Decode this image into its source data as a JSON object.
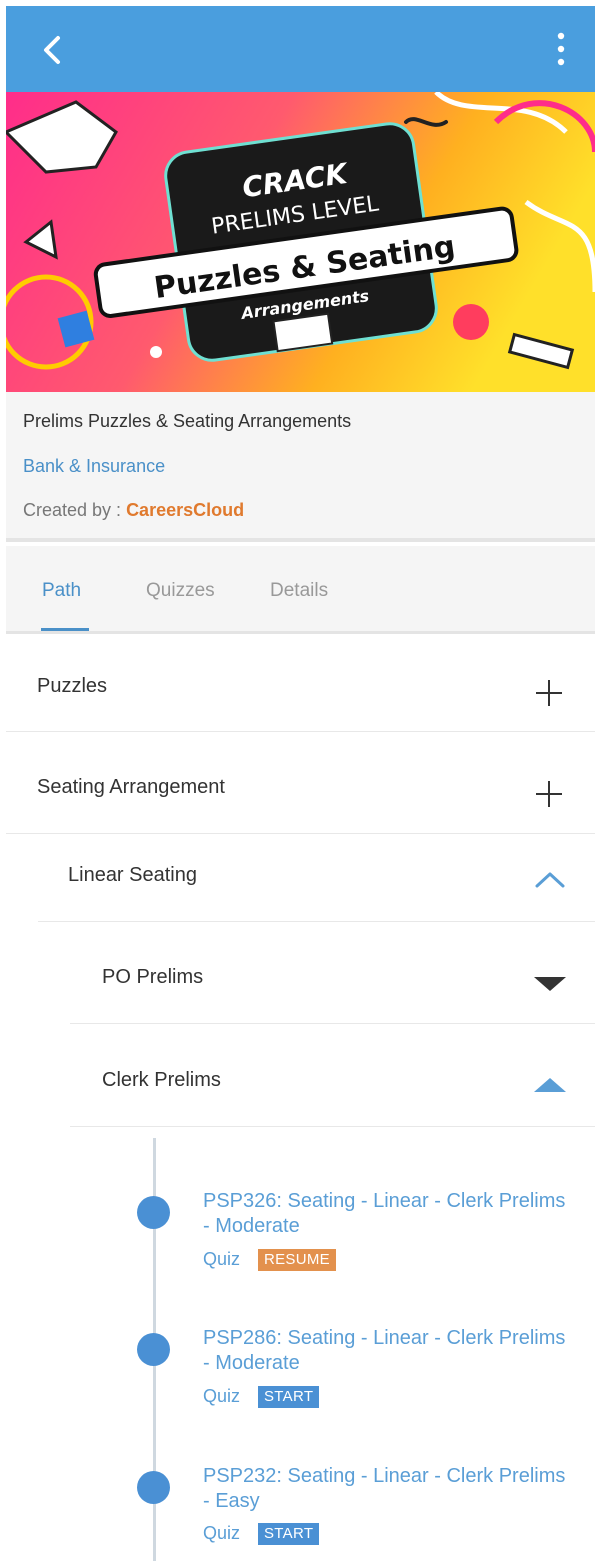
{
  "course": {
    "title": "Prelims Puzzles & Seating Arrangements",
    "category": "Bank & Insurance",
    "creator_label": "Created by : ",
    "creator_name": "CareersCloud"
  },
  "banner": {
    "line1": "CRACK",
    "line2": "PRELIMS LEVEL",
    "line3": "Puzzles & Seating",
    "line4": "Arrangements"
  },
  "tabs": [
    {
      "label": "Path",
      "active": true
    },
    {
      "label": "Quizzes",
      "active": false
    },
    {
      "label": "Details",
      "active": false
    }
  ],
  "path": {
    "sections": [
      {
        "label": "Puzzles",
        "icon": "plus-icon"
      },
      {
        "label": "Seating Arrangement",
        "icon": "plus-icon"
      }
    ],
    "subsection": {
      "label": "Linear Seating",
      "icon": "chevron-up-icon"
    },
    "groups": [
      {
        "label": "PO Prelims",
        "icon": "caret-down-icon"
      },
      {
        "label": "Clerk Prelims",
        "icon": "caret-up-icon"
      }
    ],
    "items": [
      {
        "title": "PSP326: Seating - Linear - Clerk Prelims - Moderate",
        "type": "Quiz",
        "status": "RESUME"
      },
      {
        "title": "PSP286: Seating - Linear - Clerk Prelims - Moderate",
        "type": "Quiz",
        "status": "START"
      },
      {
        "title": "PSP232: Seating - Linear - Clerk Prelims - Easy",
        "type": "Quiz",
        "status": "START"
      }
    ]
  },
  "colors": {
    "app_bar": "#4a9ede",
    "accent": "#4a90c8",
    "creator": "#e07a2e",
    "resume_badge": "#e3914d",
    "start_badge": "#4a90d4"
  }
}
